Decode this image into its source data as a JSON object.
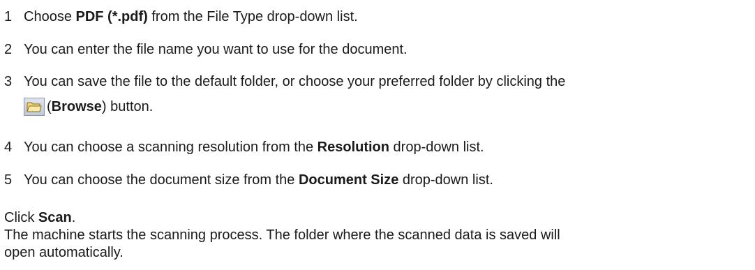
{
  "steps": [
    {
      "num": "1",
      "pre": "Choose ",
      "bold": "PDF (*.pdf)",
      "post": " from the File Type drop-down list."
    },
    {
      "num": "2",
      "text": "You can enter the file name you want to use for the document."
    },
    {
      "num": "3",
      "text": "You can save the file to the default folder, or choose your preferred folder by clicking the",
      "cont_pre": "(",
      "cont_bold": "Browse",
      "cont_post": ") button."
    },
    {
      "num": "4",
      "pre": "You can choose a scanning resolution from the ",
      "bold": "Resolution",
      "post": " drop-down list."
    },
    {
      "num": "5",
      "pre": "You can choose the document size from the ",
      "bold": "Document Size",
      "post": " drop-down list."
    }
  ],
  "final": {
    "pre": "Click ",
    "bold": "Scan",
    "post": ".",
    "line2": "The machine starts the scanning process. The folder where the scanned data is saved will",
    "line3": "open automatically."
  },
  "icons": {
    "browse": "folder-icon"
  }
}
